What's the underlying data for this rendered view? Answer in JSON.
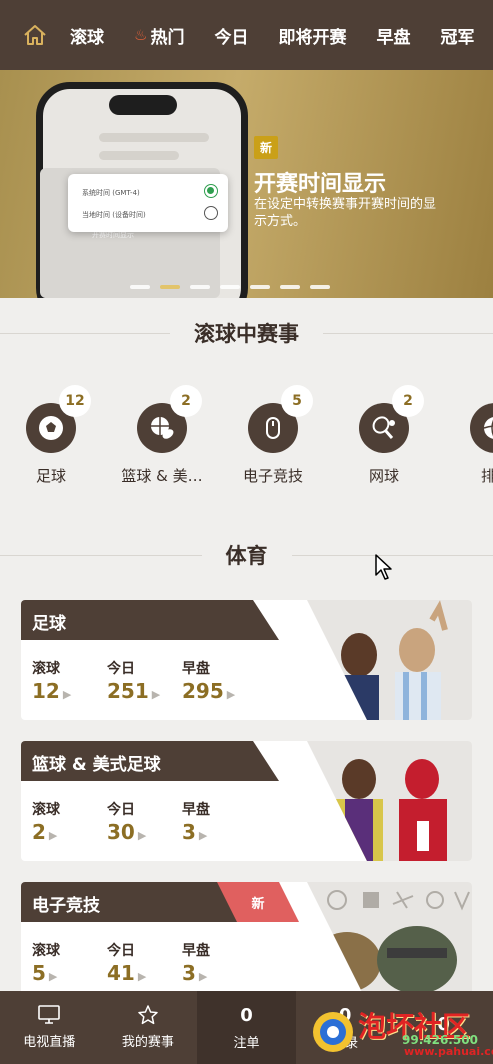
{
  "nav": {
    "items": [
      {
        "label": "滚球"
      },
      {
        "label": "热门",
        "icon": "flame-icon"
      },
      {
        "label": "今日"
      },
      {
        "label": "即将开赛"
      },
      {
        "label": "早盘"
      },
      {
        "label": "冠军"
      }
    ]
  },
  "banner": {
    "tag": "新",
    "title": "开赛时间显示",
    "desc": "在设定中转换赛事开赛时间的显示方式。",
    "dialog_opt1": "系统时间 (GMT-4)",
    "dialog_opt2": "当地时间 (设备时间)",
    "panel_text": "开赛时间显示"
  },
  "live": {
    "heading": "滚球中赛事",
    "items": [
      {
        "label": "足球",
        "count": "12",
        "icon": "soccer-ball-icon"
      },
      {
        "label": "篮球 & 美…",
        "count": "2",
        "icon": "basketball-icon"
      },
      {
        "label": "电子竞技",
        "count": "5",
        "icon": "mouse-icon"
      },
      {
        "label": "网球",
        "count": "2",
        "icon": "tennis-icon"
      },
      {
        "label": "排",
        "count": "",
        "icon": "volleyball-icon"
      }
    ]
  },
  "sports": {
    "heading": "体育",
    "cards": [
      {
        "name": "足球",
        "live_label": "滚球",
        "live": "12",
        "today_label": "今日",
        "today": "251",
        "early_label": "早盘",
        "early": "295"
      },
      {
        "name": "篮球 & 美式足球",
        "live_label": "滚球",
        "live": "2",
        "today_label": "今日",
        "today": "30",
        "early_label": "早盘",
        "early": "3"
      },
      {
        "name": "电子竞技",
        "flag": "新",
        "live_label": "滚球",
        "live": "5",
        "today_label": "今日",
        "today": "41",
        "early_label": "早盘",
        "early": "3"
      }
    ]
  },
  "bottom": {
    "tabs": [
      {
        "label": "电视直播",
        "icon": "tv-icon"
      },
      {
        "label": "我的赛事",
        "icon": "star-icon"
      },
      {
        "label": "注单",
        "num": "0"
      },
      {
        "label": "记录",
        "num": "0"
      },
      {
        "label": "",
        "num": "0"
      }
    ]
  },
  "watermark": {
    "text": "泡坏社区",
    "site": "www.pahuai.com",
    "num": "99.426.500"
  },
  "colors": {
    "brown": "#4e3f36",
    "gold": "#8c6e24",
    "red_flag": "#e0605f"
  }
}
